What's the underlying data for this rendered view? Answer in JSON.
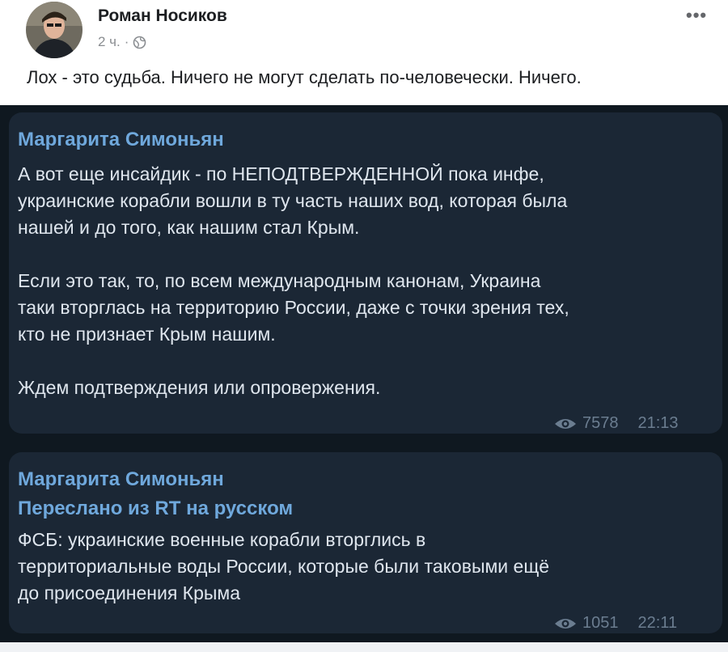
{
  "post": {
    "author": "Роман Носиков",
    "time": "2 ч.",
    "separator": "·",
    "text": "Лох - это судьба. Ничего не могут сделать по-человечески. Ничего.",
    "more": "•••"
  },
  "messages": [
    {
      "sender": "Маргарита Симоньян",
      "text": "А вот еще инсайдик - по НЕПОДТВЕРЖДЕННОЙ пока инфе,\nукраинские корабли вошли в ту  часть наших вод, которая была\nнашей и до того, как нашим стал Крым.\n\nЕсли это так, то, по всем международным канонам, Украина\nтаки вторглась на территорию России, даже с точки зрения тех,\nкто не признает Крым нашим.\n\nЖдем подтверждения или опровержения.",
      "views": "7578",
      "time": "21:13"
    },
    {
      "sender": "Маргарита Симоньян",
      "forwarded": "Переслано из RT на русском",
      "text": "ФСБ: украинские военные корабли вторглись в\nтерриториальные воды России, которые были таковыми ещё\nдо присоединения Крыма",
      "views": "1051",
      "time": "22:11"
    }
  ],
  "colors": {
    "background_dark": "#0f1820",
    "bubble": "#1b2735",
    "sender": "#6fa8dc",
    "message_text": "#dfe6ee",
    "meta": "#6b7d90"
  }
}
